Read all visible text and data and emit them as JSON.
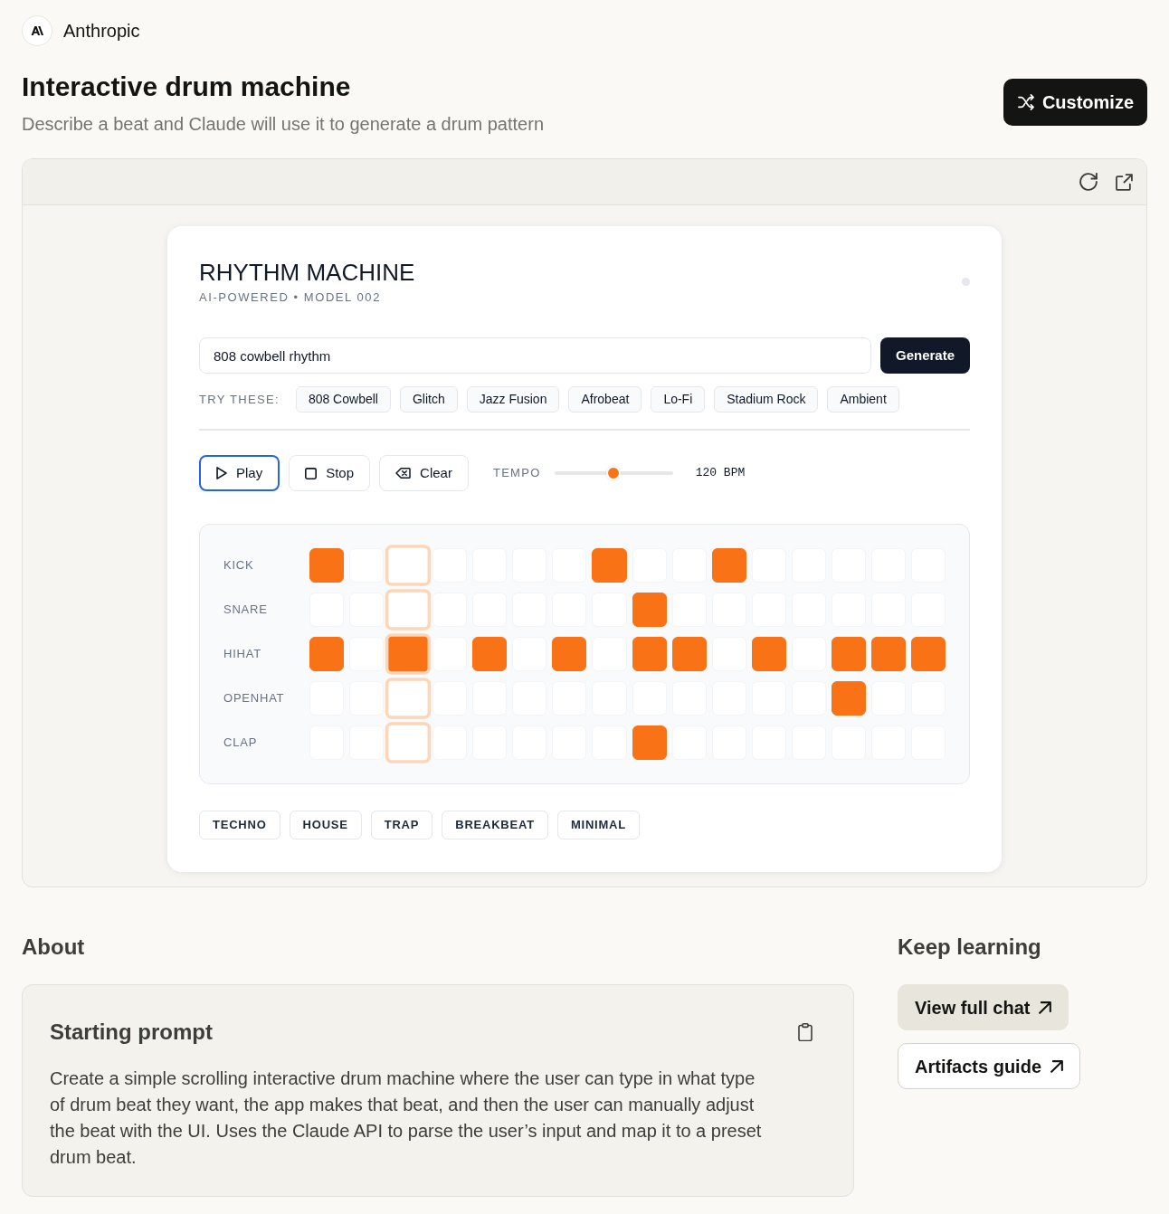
{
  "brand": {
    "name": "Anthropic"
  },
  "header": {
    "title": "Interactive drum machine",
    "subtitle": "Describe a beat and Claude will use it to generate a drum pattern",
    "action": "Customize"
  },
  "app": {
    "title": "RHYTHM MACHINE",
    "subtitle": "AI-POWERED • MODEL 002",
    "status": {
      "active": false
    },
    "prompt_field": {
      "value": "808 cowbell rhythm"
    },
    "generate": "Generate",
    "suggestions_label": "TRY THESE:",
    "suggestions": [
      "808 Cowbell",
      "Glitch",
      "Jazz Fusion",
      "Afrobeat",
      "Lo-Fi",
      "Stadium Rock",
      "Ambient"
    ],
    "transport": [
      {
        "label": "Play",
        "kind": "play",
        "focused": true
      },
      {
        "label": "Stop",
        "kind": "stop",
        "focused": false
      },
      {
        "label": "Clear",
        "kind": "clear",
        "focused": false
      }
    ],
    "tempo": {
      "label": "TEMPO",
      "level": 0.5,
      "reading": "120 BPM"
    },
    "step_columns": [
      {
        "current": false
      },
      {
        "current": false
      },
      {
        "current": true
      },
      {
        "current": false
      },
      {
        "current": false
      },
      {
        "current": false
      },
      {
        "current": false
      },
      {
        "current": false
      },
      {
        "current": false
      },
      {
        "current": false
      },
      {
        "current": false
      },
      {
        "current": false
      },
      {
        "current": false
      },
      {
        "current": false
      },
      {
        "current": false
      },
      {
        "current": false
      }
    ],
    "tracks": [
      {
        "name": "KICK",
        "steps": [
          {
            "on": true
          },
          {
            "on": false
          },
          {
            "on": false
          },
          {
            "on": false
          },
          {
            "on": false
          },
          {
            "on": false
          },
          {
            "on": false
          },
          {
            "on": true
          },
          {
            "on": false
          },
          {
            "on": false
          },
          {
            "on": true
          },
          {
            "on": false
          },
          {
            "on": false
          },
          {
            "on": false
          },
          {
            "on": false
          },
          {
            "on": false
          }
        ]
      },
      {
        "name": "SNARE",
        "steps": [
          {
            "on": false
          },
          {
            "on": false
          },
          {
            "on": false
          },
          {
            "on": false
          },
          {
            "on": false
          },
          {
            "on": false
          },
          {
            "on": false
          },
          {
            "on": false
          },
          {
            "on": true
          },
          {
            "on": false
          },
          {
            "on": false
          },
          {
            "on": false
          },
          {
            "on": false
          },
          {
            "on": false
          },
          {
            "on": false
          },
          {
            "on": false
          }
        ]
      },
      {
        "name": "HIHAT",
        "steps": [
          {
            "on": true
          },
          {
            "on": false
          },
          {
            "on": true
          },
          {
            "on": false
          },
          {
            "on": true
          },
          {
            "on": false
          },
          {
            "on": true
          },
          {
            "on": false
          },
          {
            "on": true
          },
          {
            "on": true
          },
          {
            "on": false
          },
          {
            "on": true
          },
          {
            "on": false
          },
          {
            "on": true
          },
          {
            "on": true
          },
          {
            "on": true
          }
        ]
      },
      {
        "name": "OPENHAT",
        "steps": [
          {
            "on": false
          },
          {
            "on": false
          },
          {
            "on": false
          },
          {
            "on": false
          },
          {
            "on": false
          },
          {
            "on": false
          },
          {
            "on": false
          },
          {
            "on": false
          },
          {
            "on": false
          },
          {
            "on": false
          },
          {
            "on": false
          },
          {
            "on": false
          },
          {
            "on": false
          },
          {
            "on": true
          },
          {
            "on": false
          },
          {
            "on": false
          }
        ]
      },
      {
        "name": "CLAP",
        "steps": [
          {
            "on": false
          },
          {
            "on": false
          },
          {
            "on": false
          },
          {
            "on": false
          },
          {
            "on": false
          },
          {
            "on": false
          },
          {
            "on": false
          },
          {
            "on": false
          },
          {
            "on": true
          },
          {
            "on": false
          },
          {
            "on": false
          },
          {
            "on": false
          },
          {
            "on": false
          },
          {
            "on": false
          },
          {
            "on": false
          },
          {
            "on": false
          }
        ]
      }
    ],
    "presets": [
      "TECHNO",
      "HOUSE",
      "TRAP",
      "BREAKBEAT",
      "MINIMAL"
    ]
  },
  "about": {
    "heading": "About",
    "card": {
      "title": "Starting prompt",
      "body": "Create a simple scrolling interactive drum machine where the user can type in what type of drum beat they want, the app makes that beat, and then the user can manually adjust the beat with the UI. Uses the Claude API to parse the user’s input and map it to a preset drum beat."
    }
  },
  "keep_learning": {
    "heading": "Keep learning",
    "links": [
      {
        "label": "View full chat",
        "kind": "filled"
      },
      {
        "label": "Artifacts guide",
        "kind": "outlined"
      }
    ]
  }
}
